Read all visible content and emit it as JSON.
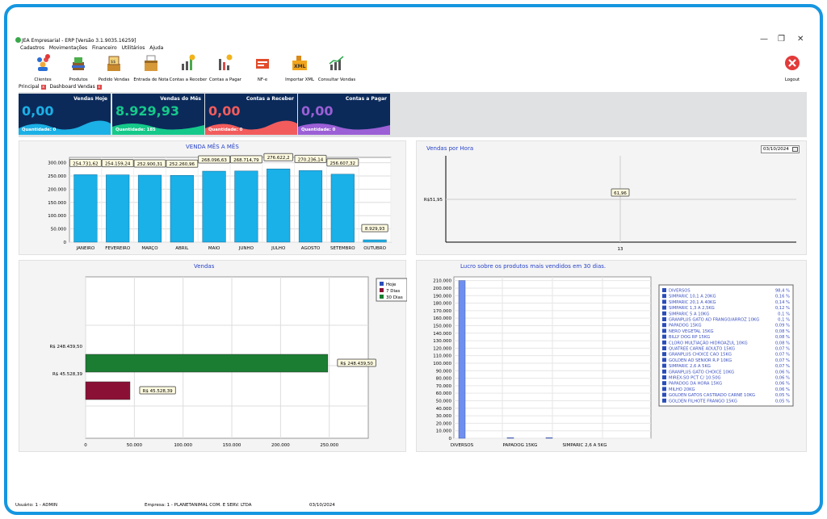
{
  "window": {
    "title": "JEA Empresarial - ERP [Versão 3.1.9035.16259]",
    "minimize": "—",
    "maximize": "❐",
    "close": "✕"
  },
  "menu": [
    "Cadastros",
    "Movimentações",
    "Financeiro",
    "Utilitários",
    "Ajuda"
  ],
  "toolbar": [
    {
      "label": "Clientes",
      "icon": "clients-icon"
    },
    {
      "label": "Produtos",
      "icon": "products-icon"
    },
    {
      "label": "Pedido Vendas",
      "icon": "sales-order-icon"
    },
    {
      "label": "Entrada de Nota",
      "icon": "invoice-entry-icon"
    },
    {
      "label": "Contas a Receber",
      "icon": "receivables-icon"
    },
    {
      "label": "Contas a Pagar",
      "icon": "payables-icon"
    },
    {
      "label": "NF-e",
      "icon": "nfe-icon"
    },
    {
      "label": "Importar XML",
      "icon": "import-xml-icon"
    },
    {
      "label": "Consultar Vendas",
      "icon": "sales-report-icon"
    },
    {
      "label": "Logout",
      "icon": "logout-icon"
    }
  ],
  "tabs": [
    "Principal",
    "Dashboard Vendas"
  ],
  "tiles": [
    {
      "title": "Vendas Hoje",
      "value": "0,00",
      "qty": "Quantidade: 0",
      "color": "#0b2a5a",
      "wave": "#1bb0e6"
    },
    {
      "title": "Vendas do Mês",
      "value": "8.929,93",
      "qty": "Quantidade: 185",
      "color": "#0b2a5a",
      "wave": "#15c98a"
    },
    {
      "title": "Contas a Receber",
      "value": "0,00",
      "qty": "Quantidade: 0",
      "color": "#0b2a5a",
      "wave": "#f25c5c"
    },
    {
      "title": "Contas a Pagar",
      "value": "0,00",
      "qty": "Quantidade: 0",
      "color": "#0b2a5a",
      "wave": "#9b5fd6"
    }
  ],
  "date_picker": {
    "value": "03/10/2024"
  },
  "status": {
    "user": "Usuário: 1 - ADMIN",
    "company": "Empresa: 1 - PLANETANIMAL COM. E SERV. LTDA",
    "date": "03/10/2024"
  },
  "chart_data": [
    {
      "type": "bar",
      "title": "VENDA MÊS A MÊS",
      "categories": [
        "JANEIRO",
        "FEVEREIRO",
        "MARÇO",
        "ABRIL",
        "MAIO",
        "JUNHO",
        "JULHO",
        "AGOSTO",
        "SETEMBRO",
        "OUTUBRO"
      ],
      "values": [
        254731.62,
        254159.24,
        252900.31,
        252260.96,
        268096.63,
        268714.79,
        276622.2,
        270236.14,
        256607.32,
        8929.93
      ],
      "data_labels": [
        "254.731,62",
        "254.159,24",
        "252.900,31",
        "252.260,96",
        "268.096,63",
        "268.714,79",
        "276.622,2",
        "270.236,14",
        "256.607,32",
        "8.929,93"
      ],
      "yticks": [
        "0",
        "50.000",
        "100.000",
        "150.000",
        "200.000",
        "250.000",
        "300.000"
      ],
      "ylim": [
        0,
        320000
      ],
      "color": "#1ab0e8"
    },
    {
      "type": "scatter",
      "title": "Vendas por Hora",
      "x": [
        13
      ],
      "y": [
        61.96
      ],
      "xticks": [
        "13"
      ],
      "yticks": [
        "R$51,95"
      ],
      "data_labels": [
        "61,96"
      ]
    },
    {
      "type": "bar",
      "title": "Vendas",
      "orientation": "horizontal",
      "series": [
        {
          "name": "Hoje",
          "value": 0,
          "color": "#2a4db8"
        },
        {
          "name": "7 Dias",
          "value": 45528.39,
          "color": "#8b1035",
          "label": "R$ 45.528,39"
        },
        {
          "name": "30 Dias",
          "value": 248439.5,
          "color": "#1a7d32",
          "label": "R$ 248.439,50"
        }
      ],
      "ylabels": [
        "R$ 248.439,50",
        "R$ 45.528,39"
      ],
      "xticks": [
        "0",
        "50.000",
        "100.000",
        "150.000",
        "200.000",
        "250.000"
      ],
      "xlim": [
        0,
        290000
      ]
    },
    {
      "type": "bar",
      "title": "Lucro sobre os produtos mais vendidos em 30 dias.",
      "categories": [
        "DIVERSOS",
        "PAPADOG 15KG",
        "SIMPARIC 2,6 A 5KG"
      ],
      "values": [
        210000,
        600,
        300
      ],
      "yticks": [
        "0",
        "10.000",
        "20.000",
        "30.000",
        "40.000",
        "50.000",
        "60.000",
        "70.000",
        "80.000",
        "90.000",
        "100.000",
        "110.000",
        "120.000",
        "130.000",
        "140.000",
        "150.000",
        "160.000",
        "170.000",
        "180.000",
        "190.000",
        "200.000",
        "210.000"
      ],
      "ylim": [
        0,
        215000
      ],
      "legend": [
        {
          "name": "DIVERSOS",
          "pct": "98,4 %"
        },
        {
          "name": "SIMPARIC 10,1 A 20KG",
          "pct": "0,16 %"
        },
        {
          "name": "SIMPARIC 20,1 A 40KG",
          "pct": "0,14 %"
        },
        {
          "name": "SIMPARIC 1,3 A 2,5KG",
          "pct": "0,12 %"
        },
        {
          "name": "SIMPARIC 5 A 10KG",
          "pct": "0,1 %"
        },
        {
          "name": "GRANPLUS GATO AD FRANGO/ARROZ 10KG",
          "pct": "0,1 %"
        },
        {
          "name": "PAPADOG 15KG",
          "pct": "0,09 %"
        },
        {
          "name": "NERO VEGETAL 15KG",
          "pct": "0,08 %"
        },
        {
          "name": "BILLY DOG RP 15KG",
          "pct": "0,08 %"
        },
        {
          "name": "CLORO MULTIAÇÃO HIDROAZUL 10KG",
          "pct": "0,08 %"
        },
        {
          "name": "QUATREE CARNE ADULTO 15KG",
          "pct": "0,07 %"
        },
        {
          "name": "GRANPLUS CHOICE CAO 15KG",
          "pct": "0,07 %"
        },
        {
          "name": "GOLDEN AD SENIOR R.P 10KG",
          "pct": "0,07 %"
        },
        {
          "name": "SIMPARIC 2,6 A 5KG",
          "pct": "0,07 %"
        },
        {
          "name": "GRANPLUS GATO CHOICE 10KG",
          "pct": "0,06 %"
        },
        {
          "name": "MIREX-SO PCT C/ 10.50G",
          "pct": "0,06 %"
        },
        {
          "name": "PAPADOG DA HORA 15KG",
          "pct": "0,06 %"
        },
        {
          "name": "MILHO 20KG",
          "pct": "0,06 %"
        },
        {
          "name": "GOLDEN GATOS CASTRADO CARNE 10KG",
          "pct": "0,05 %"
        },
        {
          "name": "GOLDEN FILHOTE FRANGO 15KG",
          "pct": "0,05 %"
        }
      ]
    }
  ]
}
